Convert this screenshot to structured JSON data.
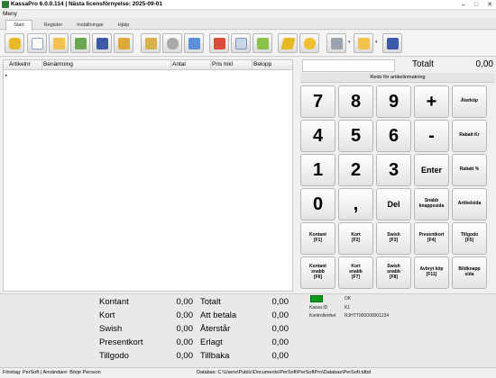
{
  "window": {
    "title": "KassaPro 6.0.0.114 | Nästa licensförnyelse: 2025-09-01",
    "controls": [
      "–",
      "□",
      "✕"
    ]
  },
  "menu": {
    "label": "Meny"
  },
  "tabs": [
    {
      "label": "Start",
      "active": true
    },
    {
      "label": "Register",
      "active": false
    },
    {
      "label": "Inställningar",
      "active": false
    },
    {
      "label": "Hjälp",
      "active": false
    }
  ],
  "toolbar": {
    "icons": [
      "database-icon",
      "new-document-icon",
      "open-folder-icon",
      "cart-icon",
      "save-icon",
      "register-icon",
      "export-icon",
      "coins-icon",
      "report-icon",
      "edit-icon",
      "settings-icon",
      "invoice-icon",
      "folder-check-icon",
      "receipt-icon",
      "number-2-icon",
      "printer-icon",
      "folder-open-icon",
      "exit-icon"
    ],
    "dropdown_glyph": "▾"
  },
  "table": {
    "columns": [
      "Artikelnr",
      "Benämning",
      "Antal",
      "Pris Inkl",
      "Belopp"
    ],
    "row_marker": "▸"
  },
  "total": {
    "label": "Totalt",
    "value": "0,00"
  },
  "status_message": "Redo för artikelinmatning",
  "keypad": [
    {
      "label": "7",
      "size": "big"
    },
    {
      "label": "8",
      "size": "big"
    },
    {
      "label": "9",
      "size": "big"
    },
    {
      "label": "+",
      "size": "big"
    },
    {
      "label": "Återköp",
      "size": "sm"
    },
    {
      "label": "4",
      "size": "big"
    },
    {
      "label": "5",
      "size": "big"
    },
    {
      "label": "6",
      "size": "big"
    },
    {
      "label": "-",
      "size": "big"
    },
    {
      "label": "Rabatt Kr",
      "size": "sm"
    },
    {
      "label": "1",
      "size": "big"
    },
    {
      "label": "2",
      "size": "big"
    },
    {
      "label": "3",
      "size": "big"
    },
    {
      "label": "Enter",
      "size": "mid"
    },
    {
      "label": "Rabatt %",
      "size": "sm"
    },
    {
      "label": "0",
      "size": "big"
    },
    {
      "label": ",",
      "size": "big"
    },
    {
      "label": "Del",
      "size": "mid"
    },
    {
      "label": "Snabb\nknappssida",
      "size": "sm"
    },
    {
      "label": "Artikelsida",
      "size": "sm"
    },
    {
      "label": "Kontant\n[F1]",
      "size": "sm"
    },
    {
      "label": "Kort\n[F2]",
      "size": "sm"
    },
    {
      "label": "Swish\n[F3]",
      "size": "sm"
    },
    {
      "label": "Presentkort\n[F4]",
      "size": "sm"
    },
    {
      "label": "Tillgodo\n[F5]",
      "size": "sm"
    },
    {
      "label": "Kontant\nsnabb\n[F6]",
      "size": "sm"
    },
    {
      "label": "Kort\nsnabb\n[F7]",
      "size": "sm"
    },
    {
      "label": "Swish\nsnabb\n[F8]",
      "size": "sm"
    },
    {
      "label": "Avbryt köp\n[F11]",
      "size": "sm"
    },
    {
      "label": "Bildknapp\nsida",
      "size": "sm"
    }
  ],
  "payments": {
    "left": [
      {
        "label": "Kontant",
        "value": "0,00"
      },
      {
        "label": "Kort",
        "value": "0,00"
      },
      {
        "label": "Swish",
        "value": "0,00"
      },
      {
        "label": "Presentkort",
        "value": "0,00"
      },
      {
        "label": "Tillgodo",
        "value": "0,00"
      }
    ],
    "right": [
      {
        "label": "Totalt",
        "value": "0,00"
      },
      {
        "label": "Att betala",
        "value": "0,00"
      },
      {
        "label": "Återstår",
        "value": "0,00"
      },
      {
        "label": "Erlagt",
        "value": "0,00"
      },
      {
        "label": "Tillbaka",
        "value": "0,00"
      }
    ]
  },
  "control_unit": {
    "status_color": "#0c9a1d",
    "status": "OK",
    "kassa_id_label": "Kassa ID",
    "kassa_id": "K1",
    "unit_label": "Kontrollenhet",
    "unit": "RJHTT000000001234"
  },
  "statusbar": {
    "company": "Företag: PerSoft | Användare: Börje Persson",
    "database": "Databas: C:\\Users\\Public\\Documents\\PerSoft\\PerSoftPro\\Databas\\PerSoft.tdbd"
  }
}
